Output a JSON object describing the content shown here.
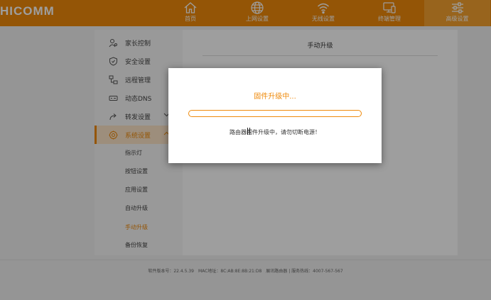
{
  "header": {
    "logo": "HICOMM",
    "nav": [
      {
        "label": "首页",
        "icon": "home-icon"
      },
      {
        "label": "上网设置",
        "icon": "globe-icon"
      },
      {
        "label": "无线设置",
        "icon": "wifi-icon"
      },
      {
        "label": "终端管理",
        "icon": "devices-icon"
      },
      {
        "label": "高级设置",
        "icon": "sliders-icon",
        "active": true
      }
    ]
  },
  "sidebar": {
    "items": [
      {
        "label": "家长控制",
        "icon": "parental-control-icon"
      },
      {
        "label": "安全设置",
        "icon": "shield-icon"
      },
      {
        "label": "远程管理",
        "icon": "remote-icon"
      },
      {
        "label": "动态DNS",
        "icon": "dns-icon"
      },
      {
        "label": "转发设置",
        "icon": "forward-icon"
      },
      {
        "label": "系统设置",
        "icon": "gear-icon",
        "active": true
      }
    ],
    "sub_items": [
      {
        "label": "指示灯"
      },
      {
        "label": "按钮设置"
      },
      {
        "label": "应用设置"
      },
      {
        "label": "自动升级"
      },
      {
        "label": "手动升级",
        "active": true
      },
      {
        "label": "备份恢复"
      }
    ]
  },
  "content": {
    "title": "手动升级"
  },
  "footer": {
    "text": "软件版本号：22.4.5.39　MAC地址：8C:AB:8E:8B:21:D8　展讯路由器 | 服务热线：4007-567-567"
  },
  "modal": {
    "title": "固件升级中...",
    "message": "路由器固件升级中，请勿切断电源！",
    "progress": 0
  },
  "colors": {
    "accent": "#ef8a0b",
    "accent_light": "#fde6c9"
  }
}
